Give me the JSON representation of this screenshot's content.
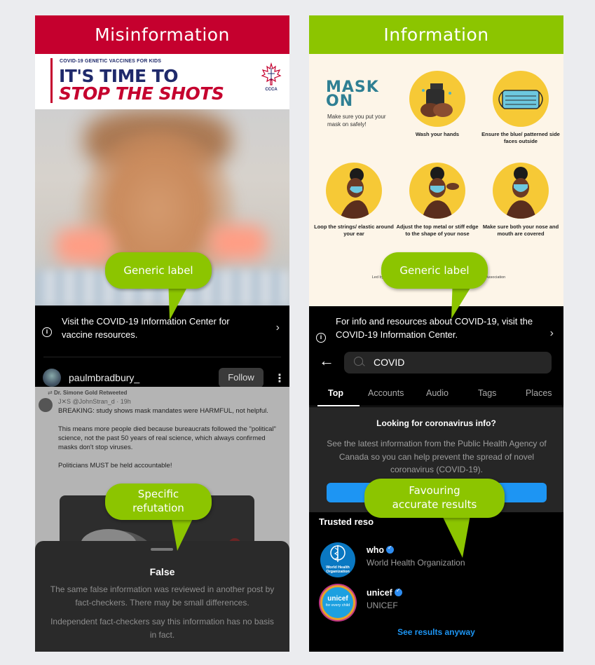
{
  "left": {
    "header": "Misinformation",
    "banner": {
      "small": "COVID-19 GENETIC VACCINES FOR KIDS",
      "line1": "IT'S TIME TO",
      "line2": "STOP THE SHOTS",
      "logo_text": "CCCA"
    },
    "info_bar": {
      "text": "Visit the COVID-19 Information Center for vaccine resources.",
      "icon": "info-icon"
    },
    "user": {
      "name": "paulmbradbury_",
      "follow": "Follow"
    },
    "tweet": {
      "retweeted": "Dr. Simone Gold Retweeted",
      "handle": "J✕S @JohnStran_d · 19h",
      "p1": "BREAKING: study shows mask mandates were HARMFUL, not helpful.",
      "p2": "This means more people died because bureaucrats followed the \"political\" science, not the past 50 years of real science, which always confirmed masks don't stop viruses.",
      "p3": "Politicians MUST be held accountable!"
    },
    "sheet": {
      "title": "False",
      "p1": "The same false information was reviewed in another post by fact-checkers. There may be small differences.",
      "p2": "Independent fact-checkers say this information has no basis in fact."
    },
    "callouts": {
      "generic": "Generic label",
      "specific_l1": "Specific",
      "specific_l2": "refutation"
    }
  },
  "right": {
    "header": "Information",
    "poster": {
      "title_l1": "MASK",
      "title_l2": "ON",
      "subtitle": "Make sure you put your mask on safely!",
      "captions": [
        "Wash your hands",
        "Ensure the blue/ patterned side faces outside",
        "Loop the strings/ elastic around your ear",
        "Adjust the top metal or stiff edge to the shape of your nose",
        "Make sure both your nose and mouth are covered"
      ],
      "footer_left": "Led by Black CAN",
      "footer_right": "dents Association"
    },
    "info_bar": {
      "text": "For info and resources about COVID-19, visit the COVID-19 Information Center.",
      "icon": "info-icon"
    },
    "search": {
      "query": "COVID"
    },
    "tabs": [
      "Top",
      "Accounts",
      "Audio",
      "Tags",
      "Places"
    ],
    "covid_info": {
      "heading": "Looking for coronavirus info?",
      "text": "See the latest information from the Public Health Agency of Canada so you can help prevent the spread of novel coronavirus (COVID-19)."
    },
    "trusted": {
      "heading": "Trusted reso",
      "accounts": [
        {
          "handle": "who",
          "name": "World Health Organization",
          "logo_l1": "World Health",
          "logo_l2": "Organization"
        },
        {
          "handle": "unicef",
          "name": "UNICEF",
          "logo_l1": "unicef",
          "logo_l2": "for every child"
        }
      ],
      "see_results": "See results anyway"
    },
    "callouts": {
      "generic": "Generic label",
      "favour_l1": "Favouring",
      "favour_l2": "accurate results"
    }
  },
  "colors": {
    "misinfo_red": "#c5002e",
    "info_green": "#8cc500",
    "ig_blue": "#1d95f3",
    "poster_yellow": "#f6c936"
  }
}
